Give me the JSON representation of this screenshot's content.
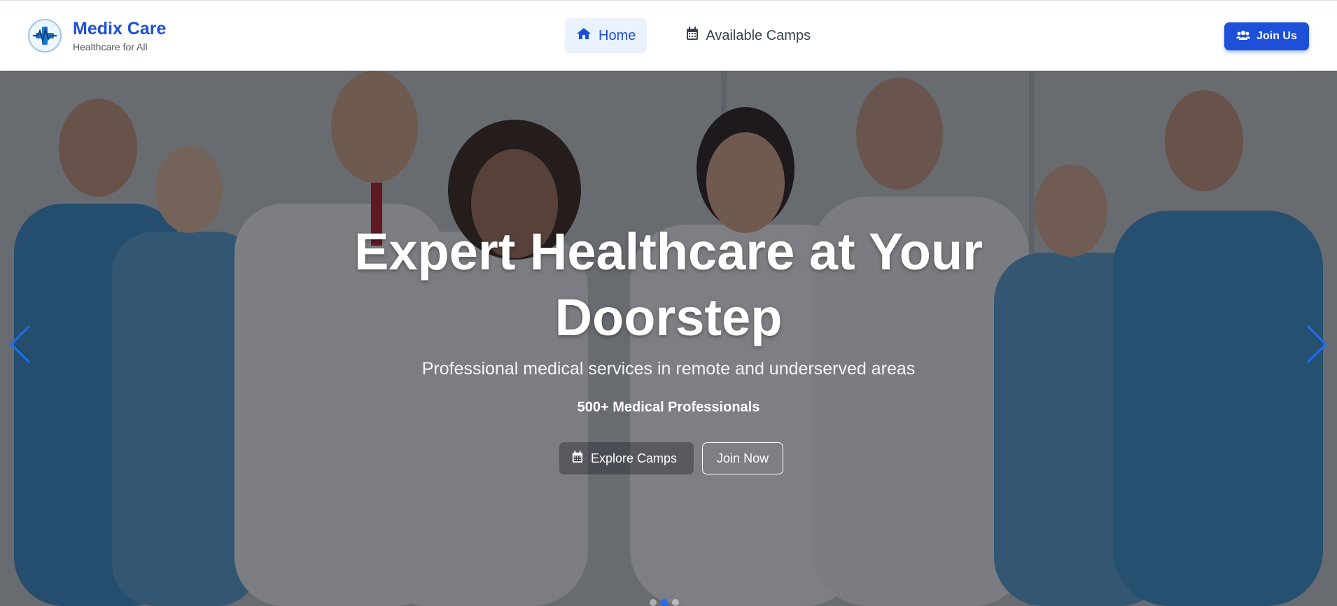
{
  "brand": {
    "name": "Medix Care",
    "tagline": "Healthcare for All",
    "logo_icon": "medical-cross-heartbeat-icon",
    "brand_color": "#1d4fd8"
  },
  "nav": {
    "items": [
      {
        "label": "Home",
        "icon": "home-icon",
        "active": true
      },
      {
        "label": "Available Camps",
        "icon": "calendar-icon",
        "active": false
      }
    ]
  },
  "header": {
    "join_label": "Join Us",
    "join_icon": "users-icon"
  },
  "hero": {
    "title_line1": "Expert Healthcare at Your",
    "title_line2": "Doorstep",
    "subtitle": "Professional medical services in remote and underserved areas",
    "stat": "500+ Medical Professionals",
    "explore_label": "Explore Camps",
    "explore_icon": "calendar-icon",
    "join_now_label": "Join Now",
    "prev_icon": "chevron-left-icon",
    "next_icon": "chevron-right-icon",
    "slides_total": 3,
    "slide_active": 2,
    "accent_color": "#1d6ff2"
  }
}
